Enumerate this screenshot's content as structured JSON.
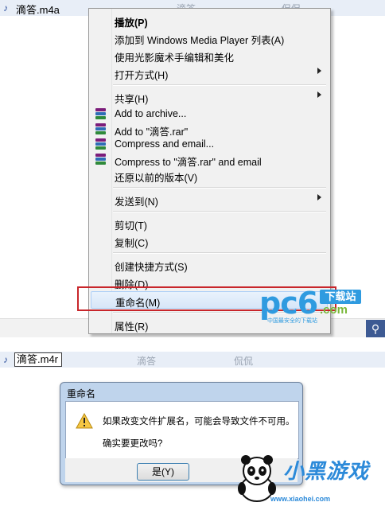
{
  "top_explorer": {
    "file_name": "滴答.m4a",
    "col_title": "滴答",
    "col_artist": "侃侃"
  },
  "context_menu": {
    "items": [
      {
        "label": "播放(P)",
        "bold": true
      },
      {
        "label": "添加到 Windows Media Player 列表(A)"
      },
      {
        "label": "使用光影魔术手编辑和美化"
      },
      {
        "label": "打开方式(H)",
        "submenu": true
      },
      {
        "label": "共享(H)",
        "submenu": true
      },
      {
        "label": "Add to archive..."
      },
      {
        "label": "Add to \"滴答.rar\""
      },
      {
        "label": "Compress and email..."
      },
      {
        "label": "Compress to \"滴答.rar\" and email"
      },
      {
        "label": "还原以前的版本(V)"
      },
      {
        "label": "发送到(N)",
        "submenu": true
      },
      {
        "label": "剪切(T)"
      },
      {
        "label": "复制(C)"
      },
      {
        "label": "创建快捷方式(S)"
      },
      {
        "label": "删除(D)"
      },
      {
        "label": "重命名(M)",
        "highlighted": true
      },
      {
        "label": "属性(R)"
      }
    ]
  },
  "watermark_pc6": {
    "logo": "pc6",
    "badge": "下载站",
    "dotcom": ".com",
    "sub": "中国最安全的下载站"
  },
  "bottom_explorer": {
    "rename_value": "滴答.m4r",
    "col_title": "滴答",
    "col_artist": "侃侃"
  },
  "dialog": {
    "title": "重命名",
    "message": "如果改变文件扩展名，可能会导致文件不可用。",
    "question": "确实要更改吗?",
    "yes_label": "是(Y)"
  },
  "watermark_xiaohei": {
    "brand": "小黑游戏",
    "url": "www.xiaohei.com"
  },
  "colors": {
    "highlight_border": "#c8262b",
    "menu_bg": "#f1f1f1",
    "dialog_frame": "#bfd4ec"
  }
}
